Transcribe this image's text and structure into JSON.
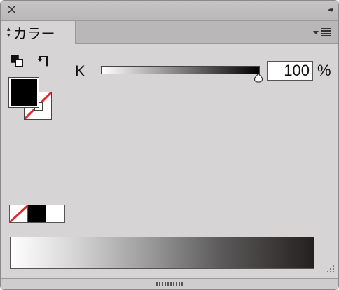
{
  "titlebar": {
    "close_glyph": "×",
    "collapse_glyph": "◂◂"
  },
  "tab": {
    "label": "カラー",
    "icon": "up-down-arrows-icon"
  },
  "panel_menu": {
    "icon": "panel-menu-icon"
  },
  "tools": {
    "defaults_icon": "default-fill-stroke-icon",
    "swap_icon": "swap-fill-stroke-icon"
  },
  "swatches": {
    "fill_color": "#000000",
    "stroke_color": "none"
  },
  "slider": {
    "channel_label": "K",
    "value": "100",
    "unit": "%",
    "level_percent": 100
  },
  "quick_swatches": [
    "none",
    "#000000",
    "#ffffff"
  ],
  "colors": {
    "accent_red": "#e0262b",
    "panel_bg": "#d6d4d4"
  }
}
